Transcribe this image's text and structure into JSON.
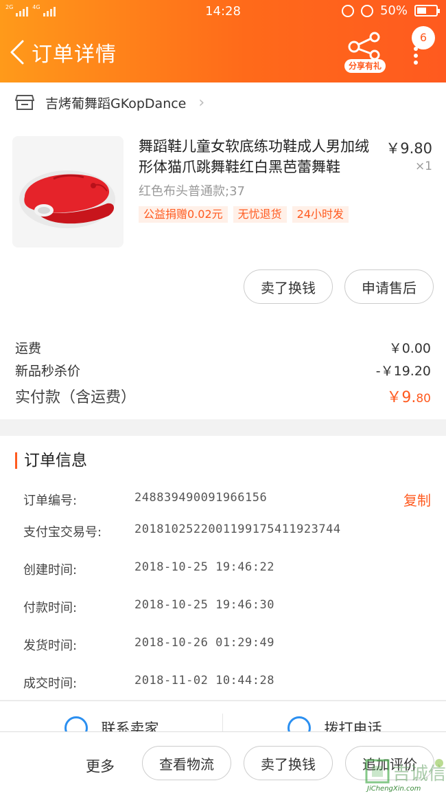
{
  "status_bar": {
    "network": [
      "2G",
      "4G"
    ],
    "time": "14:28",
    "battery": "50%",
    "battery_level": 0.5
  },
  "header": {
    "title": "订单详情",
    "share_label": "分享有礼",
    "notification_count": "6"
  },
  "shop": {
    "name": "吉烤葡舞蹈GKopDance"
  },
  "product": {
    "title": "舞蹈鞋儿童女软底练功鞋成人男加绒形体猫爪跳舞鞋红白黑芭蕾舞鞋",
    "price": "￥9.80",
    "quantity": "×1",
    "spec": "红色布头普通款;37",
    "tags": [
      "公益捐赠0.02元",
      "无忧退货",
      "24小时发"
    ]
  },
  "item_actions": {
    "sell_exchange": "卖了换钱",
    "apply_after_sale": "申请售后"
  },
  "fees": {
    "shipping_label": "运费",
    "shipping_value": "￥0.00",
    "discount_label": "新品秒杀价",
    "discount_value": "-￥19.20",
    "total_label": "实付款（含运费）",
    "total_main": "￥9.",
    "total_cents": "80"
  },
  "order_info": {
    "title": "订单信息",
    "copy_label": "复制",
    "rows": [
      {
        "label": "订单编号:",
        "value": "248839490091966156"
      },
      {
        "label": "支付宝交易号:",
        "value": "2018102522001199175411923744"
      },
      {
        "label": "创建时间:",
        "value": "2018-10-25 19:46:22"
      },
      {
        "label": "付款时间:",
        "value": "2018-10-25 19:46:30"
      },
      {
        "label": "发货时间:",
        "value": "2018-10-26 01:29:49"
      },
      {
        "label": "成交时间:",
        "value": "2018-11-02 10:44:28"
      }
    ]
  },
  "contact": {
    "seller_label": "联系卖家",
    "phone_label": "拨打电话"
  },
  "bottom_bar": {
    "more": "更多",
    "logistics": "查看物流",
    "sell_exchange": "卖了换钱",
    "add_review": "追加评价"
  },
  "watermark": {
    "text": "JiChengXin.com",
    "brand": "吉诚信"
  },
  "colors": {
    "accent": "#ff5a1f",
    "header_start": "#ff9a1a",
    "phone_blue": "#2b8ff0"
  }
}
